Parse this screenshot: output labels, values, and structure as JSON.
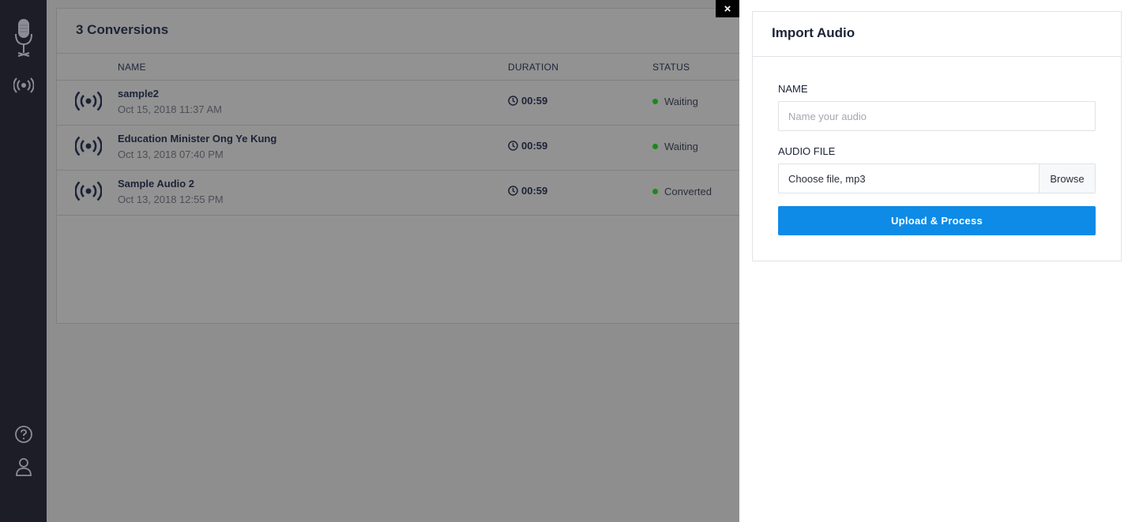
{
  "sidebar": {
    "logo_icon": "microphone-icon",
    "nav_icon": "broadcast-icon",
    "help_icon": "help-circle-icon",
    "user_icon": "user-icon"
  },
  "conversions": {
    "title": "3 Conversions",
    "columns": {
      "name": "NAME",
      "duration": "DURATION",
      "status": "STATUS"
    },
    "rows": [
      {
        "name": "sample2",
        "date": "Oct 15, 2018 11:37 AM",
        "duration": "00:59",
        "status": "Waiting"
      },
      {
        "name": "Education Minister Ong Ye Kung",
        "date": "Oct 13, 2018 07:40 PM",
        "duration": "00:59",
        "status": "Waiting"
      },
      {
        "name": "Sample Audio 2",
        "date": "Oct 13, 2018 12:55 PM",
        "duration": "00:59",
        "status": "Converted"
      }
    ]
  },
  "close_label": "×",
  "import_panel": {
    "title": "Import Audio",
    "name_label": "NAME",
    "name_placeholder": "Name your audio",
    "name_value": "",
    "file_label": "AUDIO FILE",
    "file_placeholder": "Choose file, mp3",
    "browse_label": "Browse",
    "submit_label": "Upload & Process"
  },
  "colors": {
    "sidebar_bg": "#1c1d26",
    "accent": "#0d8be6",
    "status_dot": "#1a8a1a"
  }
}
